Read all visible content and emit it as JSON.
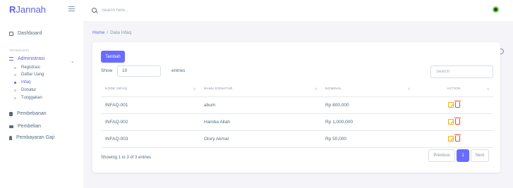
{
  "brand": {
    "initial": "R",
    "rest": "Jannah"
  },
  "search": {
    "placeholder": "Search here..."
  },
  "sidebar": {
    "dashboard": "Dashboard",
    "section": "TRANSAKSI",
    "administrasi": "Administrasi",
    "sub_items": [
      "Registrasi",
      "Daftar Uang",
      "Infaq",
      "Donatur",
      "Tunggakan"
    ],
    "pembebanan": "Pembebanan",
    "pembelian": "Pembelian",
    "pembayaran_gaji": "Pembayaran Gaji"
  },
  "breadcrumb": {
    "home": "Home",
    "separator": "/",
    "current": "Data Infaq"
  },
  "card": {
    "add_button": "Tambah",
    "show_label": "Show",
    "page_size": "10",
    "entries_label": "entries",
    "search_placeholder": "Search"
  },
  "table": {
    "columns": [
      "KODE INFAQ",
      "NAMA DONATUR",
      "NOMINAL",
      "ACTION"
    ],
    "rows": [
      {
        "kode": "INFAQ-001",
        "nama": "abum",
        "nominal": "Rp 800,000"
      },
      {
        "kode": "INFAQ-002",
        "nama": "Hamba Allah",
        "nominal": "Rp 1,000,000"
      },
      {
        "kode": "INFAQ-003",
        "nama": "Glory Akmal",
        "nominal": "Rp 50,000"
      }
    ]
  },
  "footer": {
    "info": "Showing 1 to 3 of 3 entries",
    "previous": "Previous",
    "page": "1",
    "next": "Next"
  },
  "colors": {
    "primary": "#696cff",
    "edit": "#ffab00",
    "delete": "#ff3e1d",
    "status": "#71dd37"
  },
  "icons": [
    "menu-icon",
    "search-icon",
    "home-icon",
    "list-icon",
    "stack-icon",
    "truck-icon",
    "user-icon",
    "gear-icon",
    "edit-icon",
    "trash-icon",
    "user-status-icon"
  ]
}
